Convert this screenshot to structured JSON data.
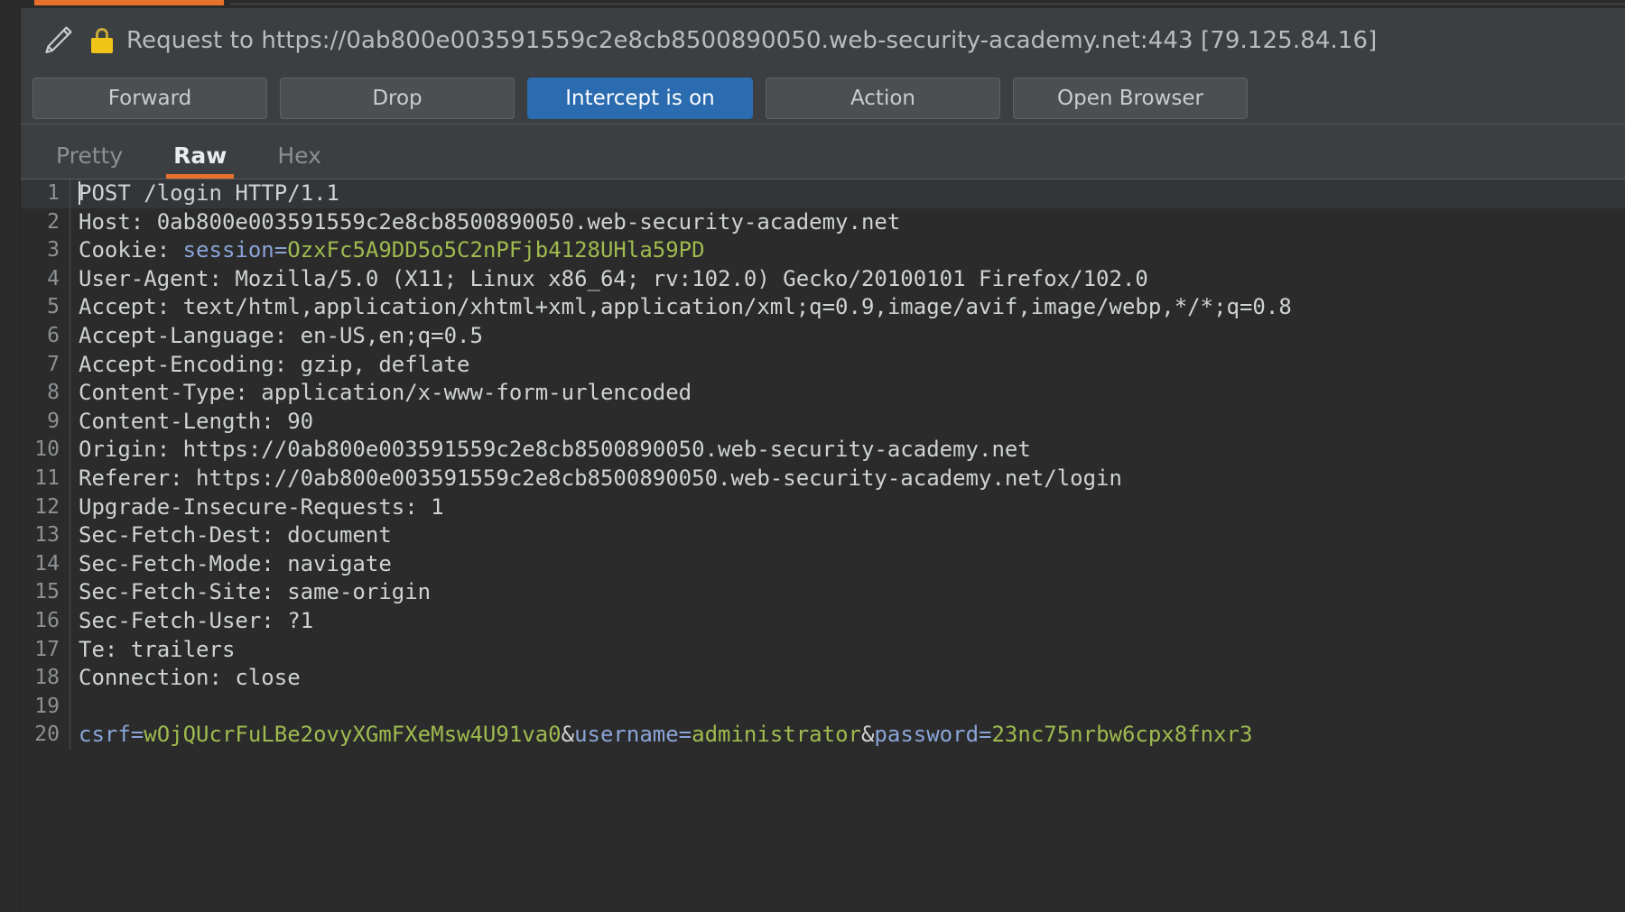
{
  "window": {
    "edit_icon": "pencil-icon",
    "secure_icon": "lock-icon",
    "request_title": "Request to https://0ab800e003591559c2e8cb8500890050.web-security-academy.net:443 [79.125.84.16]"
  },
  "toolbar": {
    "forward_label": "Forward",
    "drop_label": "Drop",
    "intercept_label": "Intercept is on",
    "action_label": "Action",
    "open_browser_label": "Open Browser",
    "intercept_active_color": "#2b6cb0"
  },
  "view_tabs": {
    "accent_color": "#e8722c",
    "items": [
      {
        "label": "Pretty",
        "active": false,
        "disabled": true
      },
      {
        "label": "Raw",
        "active": true,
        "disabled": false
      },
      {
        "label": "Hex",
        "active": false,
        "disabled": false
      }
    ]
  },
  "editor": {
    "current_line": 1,
    "lines": [
      {
        "n": "1",
        "segments": [
          {
            "t": "POST /login HTTP/1.1",
            "c": "hdr"
          }
        ]
      },
      {
        "n": "2",
        "segments": [
          {
            "t": "Host: 0ab800e003591559c2e8cb8500890050.web-security-academy.net",
            "c": "hdr"
          }
        ]
      },
      {
        "n": "3",
        "segments": [
          {
            "t": "Cookie: ",
            "c": "hdr"
          },
          {
            "t": "session",
            "c": "k"
          },
          {
            "t": "=",
            "c": "k"
          },
          {
            "t": "OzxFc5A9DD5o5C2nPFjb4128UHla59PD",
            "c": "v"
          }
        ]
      },
      {
        "n": "4",
        "segments": [
          {
            "t": "User-Agent: Mozilla/5.0 (X11; Linux x86_64; rv:102.0) Gecko/20100101 Firefox/102.0",
            "c": "hdr"
          }
        ]
      },
      {
        "n": "5",
        "segments": [
          {
            "t": "Accept: text/html,application/xhtml+xml,application/xml;q=0.9,image/avif,image/webp,*/*;q=0.8",
            "c": "hdr"
          }
        ]
      },
      {
        "n": "6",
        "segments": [
          {
            "t": "Accept-Language: en-US,en;q=0.5",
            "c": "hdr"
          }
        ]
      },
      {
        "n": "7",
        "segments": [
          {
            "t": "Accept-Encoding: gzip, deflate",
            "c": "hdr"
          }
        ]
      },
      {
        "n": "8",
        "segments": [
          {
            "t": "Content-Type: application/x-www-form-urlencoded",
            "c": "hdr"
          }
        ]
      },
      {
        "n": "9",
        "segments": [
          {
            "t": "Content-Length: 90",
            "c": "hdr"
          }
        ]
      },
      {
        "n": "10",
        "segments": [
          {
            "t": "Origin: https://0ab800e003591559c2e8cb8500890050.web-security-academy.net",
            "c": "hdr"
          }
        ]
      },
      {
        "n": "11",
        "segments": [
          {
            "t": "Referer: https://0ab800e003591559c2e8cb8500890050.web-security-academy.net/login",
            "c": "hdr"
          }
        ]
      },
      {
        "n": "12",
        "segments": [
          {
            "t": "Upgrade-Insecure-Requests: 1",
            "c": "hdr"
          }
        ]
      },
      {
        "n": "13",
        "segments": [
          {
            "t": "Sec-Fetch-Dest: document",
            "c": "hdr"
          }
        ]
      },
      {
        "n": "14",
        "segments": [
          {
            "t": "Sec-Fetch-Mode: navigate",
            "c": "hdr"
          }
        ]
      },
      {
        "n": "15",
        "segments": [
          {
            "t": "Sec-Fetch-Site: same-origin",
            "c": "hdr"
          }
        ]
      },
      {
        "n": "16",
        "segments": [
          {
            "t": "Sec-Fetch-User: ?1",
            "c": "hdr"
          }
        ]
      },
      {
        "n": "17",
        "segments": [
          {
            "t": "Te: trailers",
            "c": "hdr"
          }
        ]
      },
      {
        "n": "18",
        "segments": [
          {
            "t": "Connection: close",
            "c": "hdr"
          }
        ]
      },
      {
        "n": "19",
        "segments": [
          {
            "t": "",
            "c": "hdr"
          }
        ]
      },
      {
        "n": "20",
        "segments": [
          {
            "t": "csrf",
            "c": "k"
          },
          {
            "t": "=",
            "c": "k"
          },
          {
            "t": "wOjQUcrFuLBe2ovyXGmFXeMsw4U91va0",
            "c": "v"
          },
          {
            "t": "&",
            "c": "hdr"
          },
          {
            "t": "username",
            "c": "k"
          },
          {
            "t": "=",
            "c": "k"
          },
          {
            "t": "administrator",
            "c": "v"
          },
          {
            "t": "&",
            "c": "hdr"
          },
          {
            "t": "password",
            "c": "k"
          },
          {
            "t": "=",
            "c": "k"
          },
          {
            "t": "23nc75nrbw6cpx8fnxr3",
            "c": "v"
          }
        ]
      }
    ]
  }
}
